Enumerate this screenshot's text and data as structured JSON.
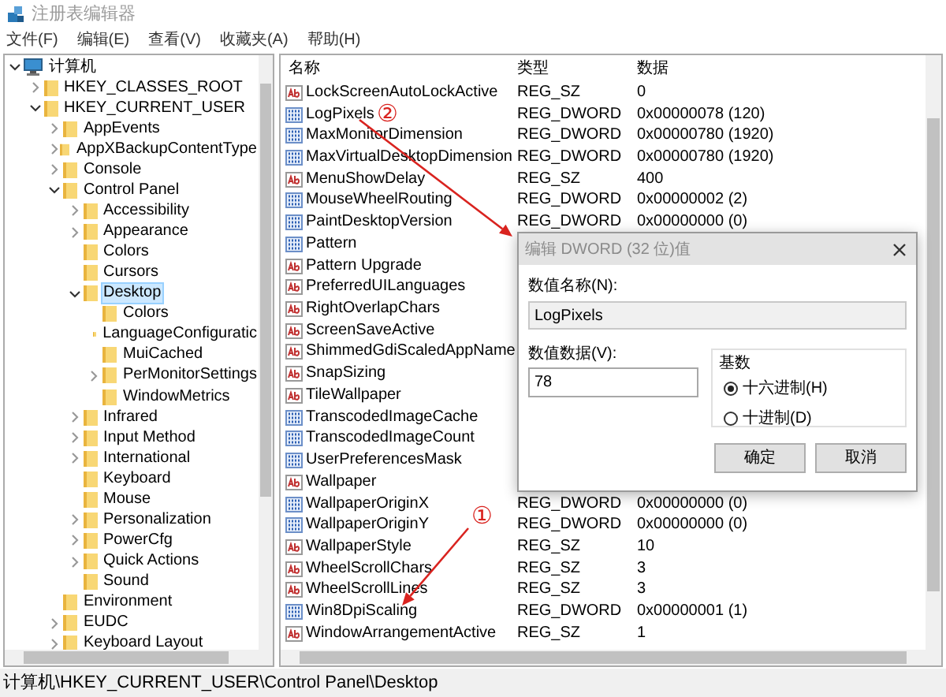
{
  "window": {
    "title": "注册表编辑器"
  },
  "menu": [
    "文件(F)",
    "编辑(E)",
    "查看(V)",
    "收藏夹(A)",
    "帮助(H)"
  ],
  "tree": [
    {
      "label": "计算机",
      "expanded": true,
      "selected": false,
      "kind": "computer",
      "children": [
        {
          "label": "HKEY_CLASSES_ROOT",
          "expanded": false,
          "selected": false
        },
        {
          "label": "HKEY_CURRENT_USER",
          "expanded": true,
          "selected": false,
          "children": [
            {
              "label": "AppEvents",
              "expanded": false,
              "selected": false
            },
            {
              "label": "AppXBackupContentType",
              "expanded": false,
              "selected": false
            },
            {
              "label": "Console",
              "expanded": false,
              "selected": false
            },
            {
              "label": "Control Panel",
              "expanded": true,
              "selected": false,
              "children": [
                {
                  "label": "Accessibility",
                  "expanded": false,
                  "selected": false
                },
                {
                  "label": "Appearance",
                  "expanded": false,
                  "selected": false
                },
                {
                  "label": "Colors",
                  "selected": false
                },
                {
                  "label": "Cursors",
                  "selected": false
                },
                {
                  "label": "Desktop",
                  "expanded": true,
                  "selected": true,
                  "children": [
                    {
                      "label": "Colors",
                      "selected": false
                    },
                    {
                      "label": "LanguageConfiguratic",
                      "selected": false
                    },
                    {
                      "label": "MuiCached",
                      "selected": false
                    },
                    {
                      "label": "PerMonitorSettings",
                      "expanded": false,
                      "selected": false
                    },
                    {
                      "label": "WindowMetrics",
                      "selected": false
                    }
                  ]
                },
                {
                  "label": "Infrared",
                  "expanded": false,
                  "selected": false
                },
                {
                  "label": "Input Method",
                  "expanded": false,
                  "selected": false
                },
                {
                  "label": "International",
                  "expanded": false,
                  "selected": false
                },
                {
                  "label": "Keyboard",
                  "selected": false
                },
                {
                  "label": "Mouse",
                  "selected": false
                },
                {
                  "label": "Personalization",
                  "expanded": false,
                  "selected": false
                },
                {
                  "label": "PowerCfg",
                  "expanded": false,
                  "selected": false
                },
                {
                  "label": "Quick Actions",
                  "expanded": false,
                  "selected": false
                },
                {
                  "label": "Sound",
                  "selected": false
                }
              ]
            },
            {
              "label": "Environment",
              "selected": false
            },
            {
              "label": "EUDC",
              "expanded": false,
              "selected": false
            },
            {
              "label": "Keyboard Layout",
              "expanded": false,
              "selected": false
            }
          ]
        }
      ]
    }
  ],
  "table": {
    "columns": [
      "名称",
      "类型",
      "数据"
    ],
    "rows": [
      {
        "kind": "sz",
        "name": "LockScreenAutoLockActive",
        "type": "REG_SZ",
        "data": "0"
      },
      {
        "kind": "dword",
        "name": "LogPixels",
        "type": "REG_DWORD",
        "data": "0x00000078 (120)"
      },
      {
        "kind": "dword",
        "name": "MaxMonitorDimension",
        "type": "REG_DWORD",
        "data": "0x00000780 (1920)"
      },
      {
        "kind": "dword",
        "name": "MaxVirtualDesktopDimension",
        "type": "REG_DWORD",
        "data": "0x00000780 (1920)"
      },
      {
        "kind": "sz",
        "name": "MenuShowDelay",
        "type": "REG_SZ",
        "data": "400"
      },
      {
        "kind": "dword",
        "name": "MouseWheelRouting",
        "type": "REG_DWORD",
        "data": "0x00000002 (2)"
      },
      {
        "kind": "dword",
        "name": "PaintDesktopVersion",
        "type": "REG_DWORD",
        "data": "0x00000000 (0)"
      },
      {
        "kind": "dword",
        "name": "Pattern"
      },
      {
        "kind": "sz",
        "name": "Pattern Upgrade"
      },
      {
        "kind": "sz",
        "name": "PreferredUILanguages"
      },
      {
        "kind": "sz",
        "name": "RightOverlapChars"
      },
      {
        "kind": "sz",
        "name": "ScreenSaveActive"
      },
      {
        "kind": "sz",
        "name": "ShimmedGdiScaledAppName"
      },
      {
        "kind": "sz",
        "name": "SnapSizing"
      },
      {
        "kind": "sz",
        "name": "TileWallpaper"
      },
      {
        "kind": "dword",
        "name": "TranscodedImageCache"
      },
      {
        "kind": "dword",
        "name": "TranscodedImageCount"
      },
      {
        "kind": "dword",
        "name": "UserPreferencesMask"
      },
      {
        "kind": "sz",
        "name": "Wallpaper"
      },
      {
        "kind": "dword",
        "name": "WallpaperOriginX",
        "type": "REG_DWORD",
        "data": "0x00000000 (0)"
      },
      {
        "kind": "dword",
        "name": "WallpaperOriginY",
        "type": "REG_DWORD",
        "data": "0x00000000 (0)"
      },
      {
        "kind": "sz",
        "name": "WallpaperStyle",
        "type": "REG_SZ",
        "data": "10"
      },
      {
        "kind": "sz",
        "name": "WheelScrollChars",
        "type": "REG_SZ",
        "data": "3"
      },
      {
        "kind": "sz",
        "name": "WheelScrollLines",
        "type": "REG_SZ",
        "data": "3"
      },
      {
        "kind": "dword",
        "name": "Win8DpiScaling",
        "type": "REG_DWORD",
        "data": "0x00000001 (1)"
      },
      {
        "kind": "sz",
        "name": "WindowArrangementActive",
        "type": "REG_SZ",
        "data": "1"
      }
    ]
  },
  "dialog": {
    "title": "编辑 DWORD (32 位)值",
    "name_label": "数值名称(N):",
    "name_value": "LogPixels",
    "data_label": "数值数据(V):",
    "data_value": "78",
    "base_label": "基数",
    "bases": [
      {
        "label": "十六进制(H)",
        "selected": true
      },
      {
        "label": "十进制(D)",
        "selected": false
      }
    ],
    "buttons": [
      "确定",
      "取消"
    ]
  },
  "annotations": [
    {
      "label": "②"
    },
    {
      "label": "①"
    }
  ],
  "status_bar": "计算机\\HKEY_CURRENT_USER\\Control Panel\\Desktop"
}
